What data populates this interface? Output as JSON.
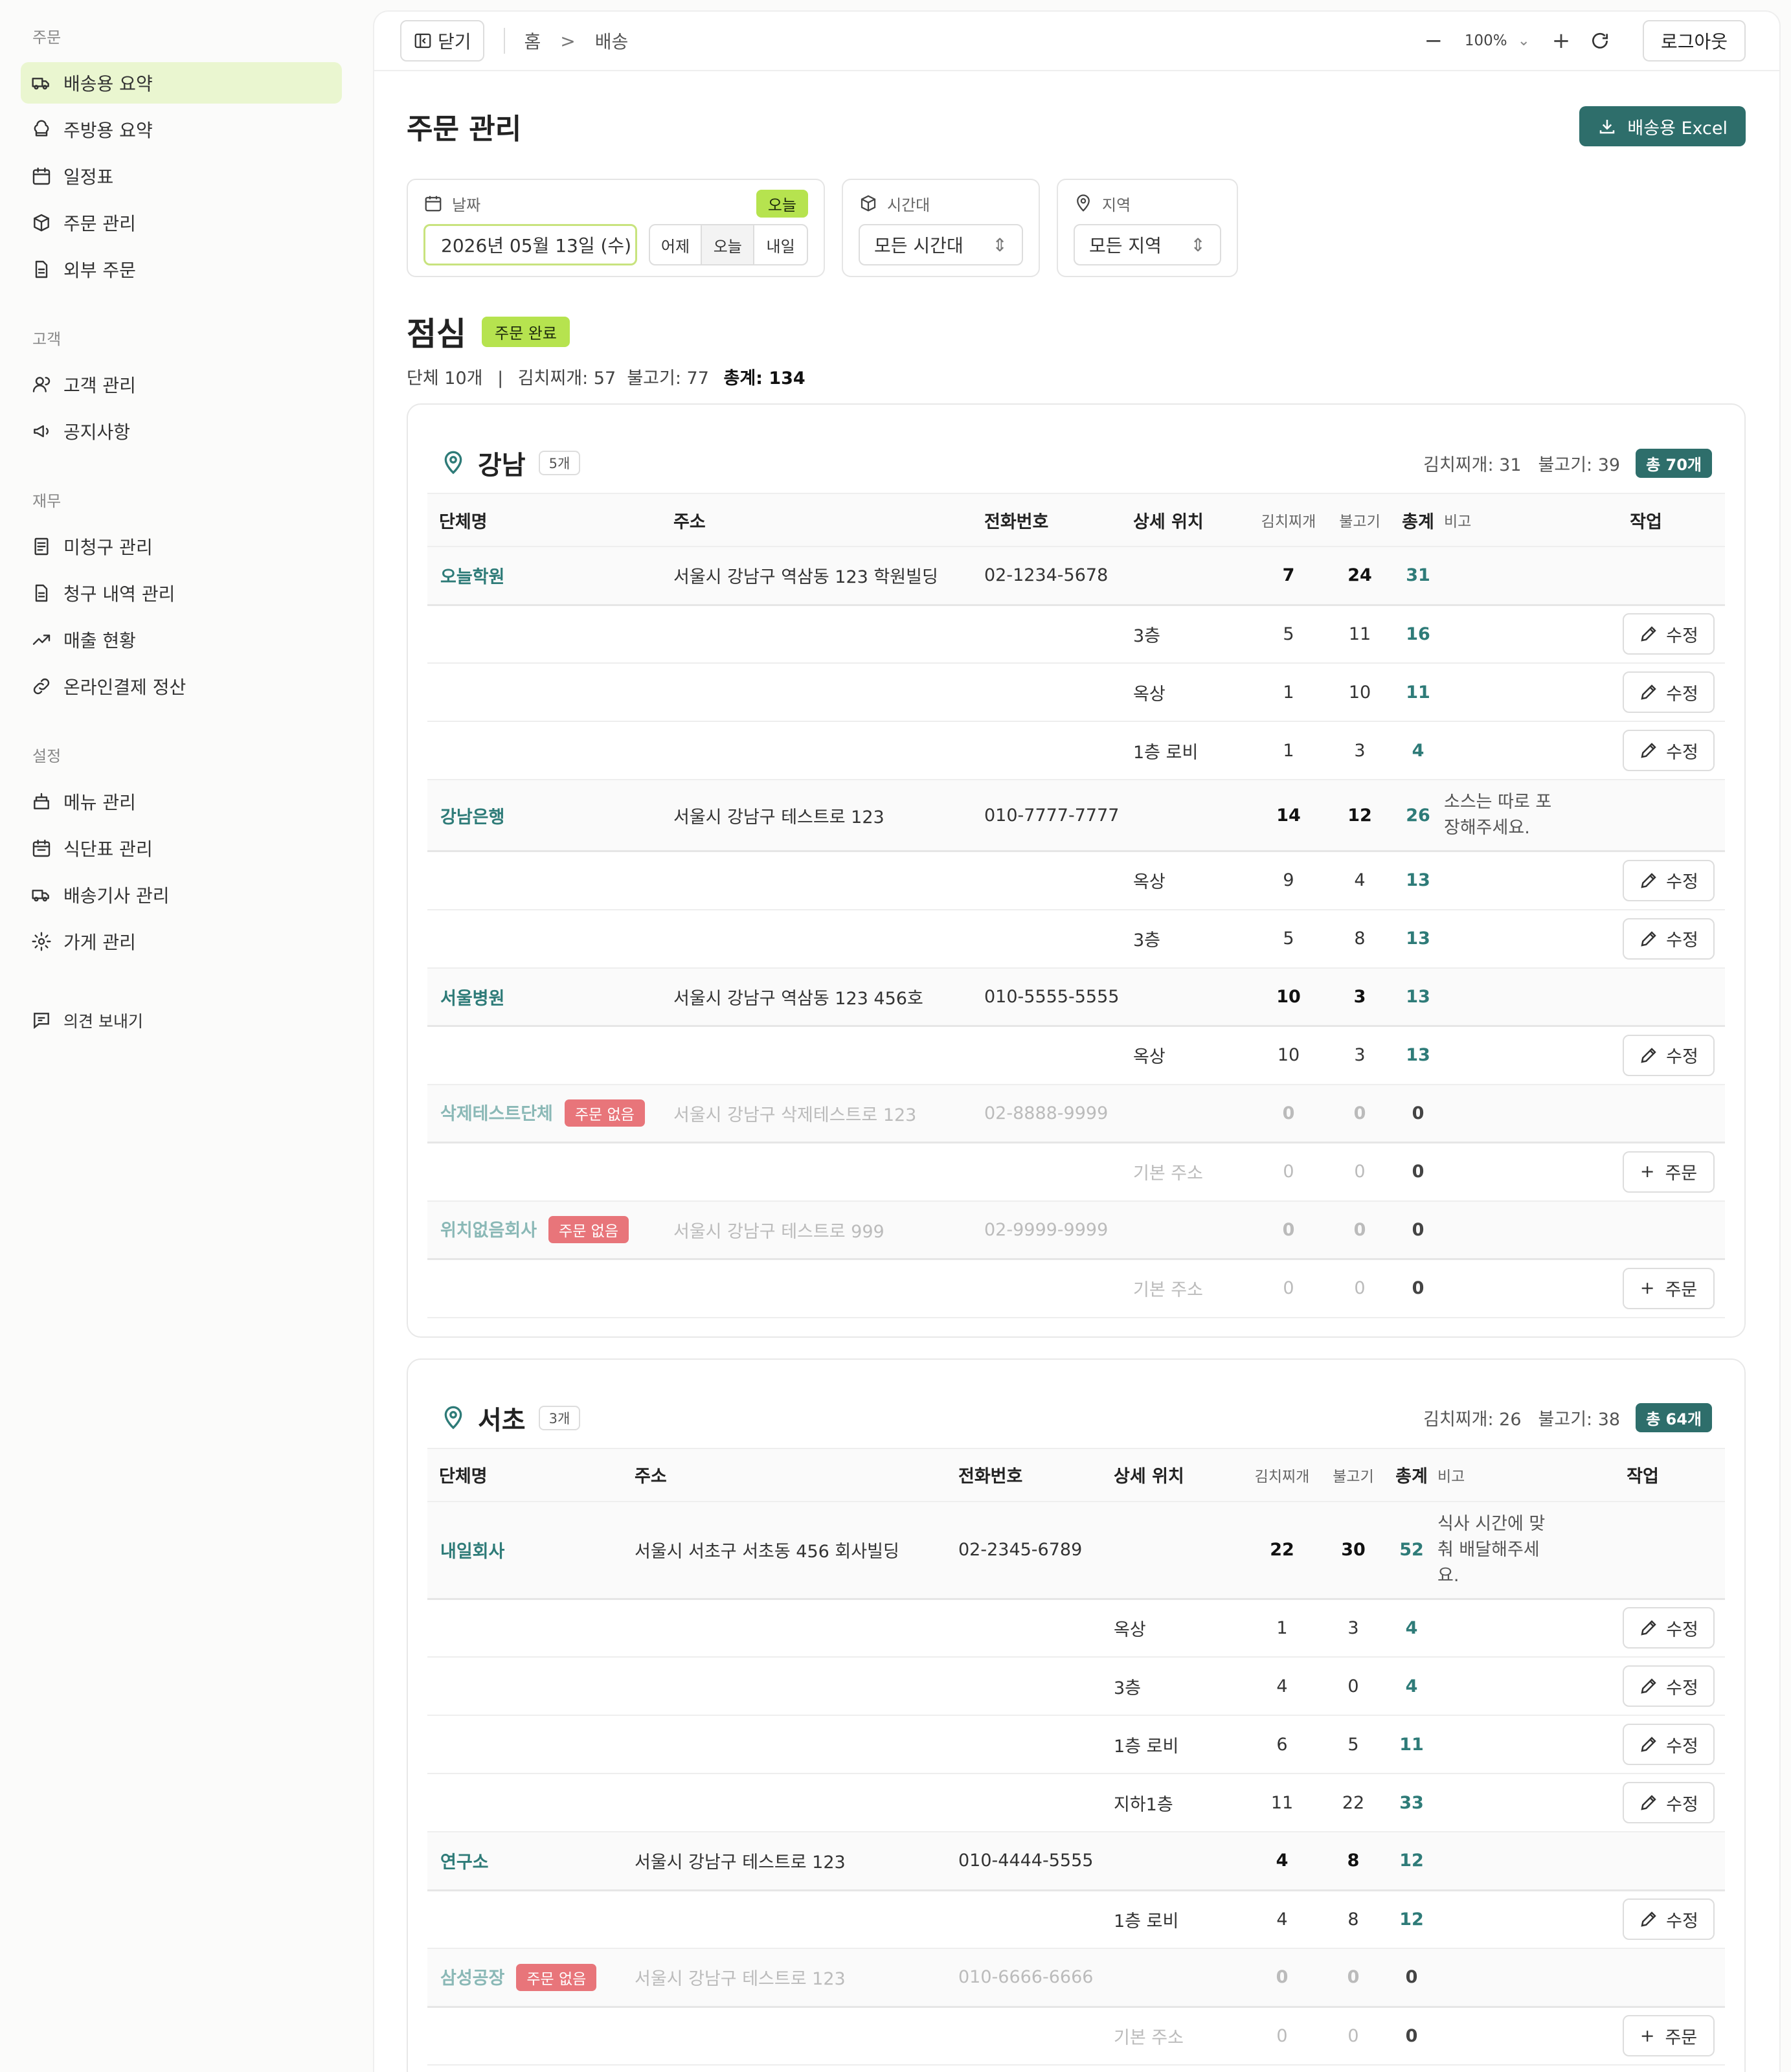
{
  "sidebar": {
    "sections": [
      {
        "label": "주문",
        "items": [
          "배송용 요약",
          "주방용 요약",
          "일정표",
          "주문 관리",
          "외부 주문"
        ]
      },
      {
        "label": "고객",
        "items": [
          "고객 관리",
          "공지사항"
        ]
      },
      {
        "label": "재무",
        "items": [
          "미청구 관리",
          "청구 내역 관리",
          "매출 현황",
          "온라인결제 정산"
        ]
      },
      {
        "label": "설정",
        "items": [
          "메뉴 관리",
          "식단표 관리",
          "배송기사 관리",
          "가게 관리"
        ]
      }
    ],
    "feedback": "의견 보내기"
  },
  "topbar": {
    "close": "닫기",
    "breadcrumb_home": "홈",
    "breadcrumb_sep": ">",
    "breadcrumb_current": "배송",
    "zoom": "100%",
    "logout": "로그아웃"
  },
  "page": {
    "title": "주문 관리",
    "excel_button": "배송용 Excel"
  },
  "filters": {
    "date_label": "날짜",
    "today_badge": "오늘",
    "date_value": "2026년 05월 13일 (수)",
    "seg": [
      "어제",
      "오늘",
      "내일"
    ],
    "time_label": "시간대",
    "time_value": "모든 시간대",
    "region_label": "지역",
    "region_value": "모든 지역"
  },
  "meal": {
    "title": "점심",
    "status": "주문 완료",
    "summary_a": "단체 10개",
    "summary_sep": "|",
    "summary_b": "김치찌개: 57  불고기: 77",
    "summary_total": "총계: 134"
  },
  "columns": [
    "단체명",
    "주소",
    "전화번호",
    "상세 위치",
    "김치찌개",
    "불고기",
    "총계",
    "비고",
    "작업"
  ],
  "labels": {
    "edit": "수정",
    "order": "주문",
    "no_order": "주문 없음"
  },
  "regions": [
    {
      "name": "강남",
      "count": "5개",
      "kimchi": "김치찌개: 31",
      "bulgogi": "불고기: 39",
      "total": "총 70개",
      "orgs": [
        {
          "name": "오늘학원",
          "addr": "서울시 강남구 역삼동 123 학원빌딩",
          "phone": "02-1234-5678",
          "k": "7",
          "b": "24",
          "t": "31",
          "note": "",
          "locs": [
            {
              "loc": "3층",
              "k": "5",
              "b": "11",
              "t": "16"
            },
            {
              "loc": "옥상",
              "k": "1",
              "b": "10",
              "t": "11"
            },
            {
              "loc": "1층 로비",
              "k": "1",
              "b": "3",
              "t": "4"
            }
          ]
        },
        {
          "name": "강남은행",
          "addr": "서울시 강남구 테스트로 123",
          "phone": "010-7777-7777",
          "k": "14",
          "b": "12",
          "t": "26",
          "note": "소스는 따로 포장해주세요.",
          "locs": [
            {
              "loc": "옥상",
              "k": "9",
              "b": "4",
              "t": "13"
            },
            {
              "loc": "3층",
              "k": "5",
              "b": "8",
              "t": "13"
            }
          ]
        },
        {
          "name": "서울병원",
          "addr": "서울시 강남구 역삼동 123 456호",
          "phone": "010-5555-5555",
          "k": "10",
          "b": "3",
          "t": "13",
          "note": "",
          "locs": [
            {
              "loc": "옥상",
              "k": "10",
              "b": "3",
              "t": "13"
            }
          ]
        },
        {
          "name": "삭제테스트단체",
          "none": true,
          "addr": "서울시 강남구 삭제테스트로 123",
          "phone": "02-8888-9999",
          "k": "0",
          "b": "0",
          "t": "0",
          "note": "",
          "locs": [
            {
              "loc": "기본 주소",
              "k": "0",
              "b": "0",
              "t": "0"
            }
          ]
        },
        {
          "name": "위치없음회사",
          "none": true,
          "addr": "서울시 강남구 테스트로 999",
          "phone": "02-9999-9999",
          "k": "0",
          "b": "0",
          "t": "0",
          "note": "",
          "locs": [
            {
              "loc": "기본 주소",
              "k": "0",
              "b": "0",
              "t": "0"
            }
          ]
        }
      ]
    },
    {
      "name": "서초",
      "count": "3개",
      "kimchi": "김치찌개: 26",
      "bulgogi": "불고기: 38",
      "total": "총 64개",
      "orgs": [
        {
          "name": "내일회사",
          "addr": "서울시 서초구 서초동 456 회사빌딩",
          "phone": "02-2345-6789",
          "k": "22",
          "b": "30",
          "t": "52",
          "note": "식사 시간에 맞춰 배달해주세요.",
          "locs": [
            {
              "loc": "옥상",
              "k": "1",
              "b": "3",
              "t": "4"
            },
            {
              "loc": "3층",
              "k": "4",
              "b": "0",
              "t": "4"
            },
            {
              "loc": "1층 로비",
              "k": "6",
              "b": "5",
              "t": "11"
            },
            {
              "loc": "지하1층",
              "k": "11",
              "b": "22",
              "t": "33"
            }
          ]
        },
        {
          "name": "연구소",
          "addr": "서울시 강남구 테스트로 123",
          "phone": "010-4444-5555",
          "k": "4",
          "b": "8",
          "t": "12",
          "note": "",
          "locs": [
            {
              "loc": "1층 로비",
              "k": "4",
              "b": "8",
              "t": "12"
            }
          ]
        },
        {
          "name": "삼성공장",
          "none": true,
          "addr": "서울시 강남구 테스트로 123",
          "phone": "010-6666-6666",
          "k": "0",
          "b": "0",
          "t": "0",
          "note": "",
          "locs": [
            {
              "loc": "기본 주소",
              "k": "0",
              "b": "0",
              "t": "0"
            }
          ]
        }
      ]
    }
  ]
}
